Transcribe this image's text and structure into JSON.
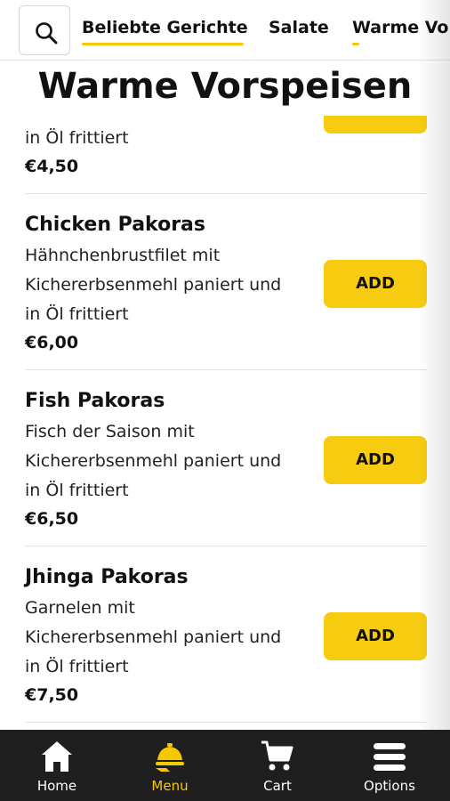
{
  "categories": {
    "tabs": [
      {
        "label": "Beliebte Gerichte",
        "active": true
      },
      {
        "label": "Salate",
        "active": false
      },
      {
        "label": "Warme Vo",
        "active": false
      }
    ],
    "search_icon": "search-icon"
  },
  "section": {
    "title": "Warme Vorspeisen"
  },
  "items": [
    {
      "name": "",
      "desc_lines": [
        "in Öl frittiert"
      ],
      "price": "€4,50",
      "add_label": ""
    },
    {
      "name": "Chicken Pakoras",
      "desc_lines": [
        "Hähnchenbrustfilet mit",
        "Kichererbsenmehl paniert und",
        "in Öl frittiert"
      ],
      "price": "€6,00",
      "add_label": "ADD"
    },
    {
      "name": "Fish Pakoras",
      "desc_lines": [
        "Fisch der Saison mit",
        "Kichererbsenmehl paniert und",
        "in Öl frittiert"
      ],
      "price": "€6,50",
      "add_label": "ADD"
    },
    {
      "name": "Jhinga Pakoras",
      "desc_lines": [
        "Garnelen mit",
        "Kichererbsenmehl paniert und",
        "in Öl frittiert"
      ],
      "price": "€7,50",
      "add_label": "ADD"
    }
  ],
  "bottom_nav": [
    {
      "label": "Home",
      "icon": "home-icon",
      "active": false
    },
    {
      "label": "Menu",
      "icon": "menu-cloche-icon",
      "active": true
    },
    {
      "label": "Cart",
      "icon": "cart-icon",
      "active": false
    },
    {
      "label": "Options",
      "icon": "options-icon",
      "active": false
    }
  ],
  "colors": {
    "accent": "#f7cb0f",
    "nav_background": "#1f1f1f",
    "active_nav": "#f5c800"
  }
}
